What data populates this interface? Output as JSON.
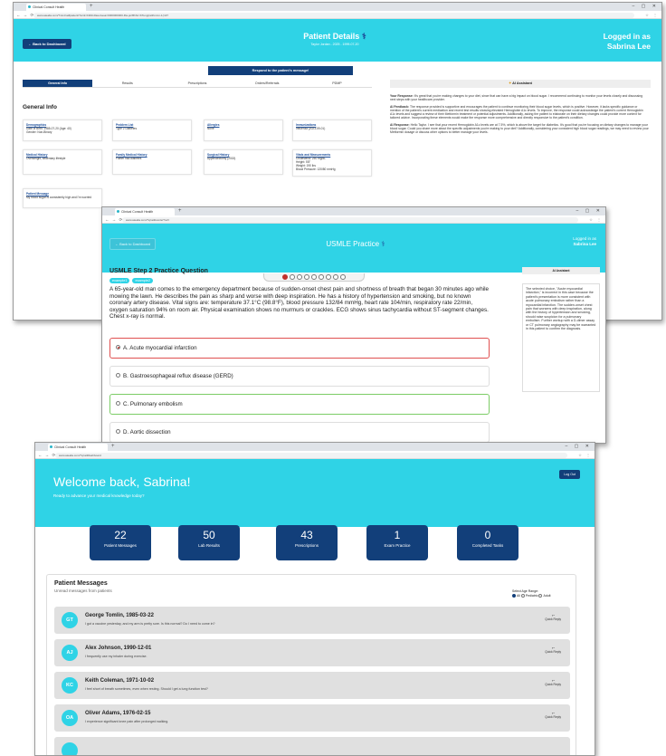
{
  "w1": {
    "tab": "Clinical Consult Health",
    "url": "www.atealia.com/?mini=ai#patient/?a=&=1990-Raw-baoa=0000000000-Rw-ja=Bhhn=KTeng(/atthmmn-1(=&?",
    "back": "← Back to Dashboard",
    "title": "Patient Details",
    "subtitle": "Taylor Jordan - 2025 - 1999-07-20",
    "logged_a": "Logged in as",
    "logged_b": "Sabrina Lee",
    "respond": "Respond to the patient's message!",
    "tabs": [
      "General Info",
      "Results",
      "Prescriptions",
      "Orders/Referrals",
      "PDMP"
    ],
    "section": "General Info",
    "cards": [
      {
        "t": "Demographics",
        "l": [
          "Date of Birth: 1985-07-20 (Age: 40)",
          "Gender: Non-Binary"
        ]
      },
      {
        "t": "Problem List",
        "l": [
          "Type 2 Diabetes"
        ]
      },
      {
        "t": "Allergies",
        "l": [
          "None"
        ]
      },
      {
        "t": "Immunizations",
        "l": [
          "Influenza (2023-09-01)"
        ]
      },
      {
        "t": "Medical History",
        "l": [
          "Overweight, sedentary lifestyle"
        ]
      },
      {
        "t": "Family Medical History",
        "l": [
          "Father had diabetes"
        ]
      },
      {
        "t": "Surgical History",
        "l": [
          "Appendectomy (2015)"
        ]
      },
      {
        "t": "Vitals and Measurements",
        "l": [
          "Cholesterol: 250 mg/dL",
          "Height: 5'8\"",
          "Weight: 190 lbs",
          "Blood Pressure: 120/80 mmHg"
        ]
      },
      {
        "t": "Patient Message",
        "l": [
          "My blood sugar is consistently high and I'm worried"
        ]
      }
    ],
    "ai_header": "AI Assistant",
    "ai": [
      {
        "k": "Your Response:",
        "v": "It's great that you're making changes to your diet, since that can have a big impact on blood sugar. I recommend continuing to monitor your levels closely and discussing next steps with your healthcare provider."
      },
      {
        "k": "AI Feedback:",
        "v": "The response provided is supportive and encourages the patient to continue monitoring their blood sugar levels, which is positive. However, it lacks specific guidance or mention of the patient's current medication and recent test results showing elevated Hemoglobin A1c levels. To improve, the response could acknowledge the patient's current Hemoglobin A1c levels and suggest a review of their Metformin treatment or potential adjustments. Additionally, asking the patient to elaborate on their dietary changes could provide more context for tailored advice. Incorporating these elements would make the response more comprehensive and directly responsive to the patient's condition."
      },
      {
        "k": "AI Response:",
        "v": "Hello Taylor. I see that your recent Hemoglobin A1c levels are at 7.5%, which is above the target for diabetics. It's good that you're focusing on dietary changes to manage your blood sugar. Could you share more about the specific adjustments you're making to your diet? Additionally, considering your consistent high blood sugar readings, we may need to review your Metformin dosage or discuss other options to better manage your levels."
      }
    ]
  },
  "w2": {
    "tab": "Clinical Consult Health",
    "url": "www.atealia.com/?q=ai#usmle/?ref=",
    "back": "← Back to Dashboard",
    "title": "USMLE Practice",
    "logged_a": "Logged in as",
    "logged_b": "Sabrina Lee",
    "qtitle": "USMLE Step 2 Practice Question",
    "tags": [
      "example1",
      "example2"
    ],
    "question": "A 65-year-old man comes to the emergency department because of sudden-onset chest pain and shortness of breath that began 30 minutes ago while mowing the lawn. He describes the pain as sharp and worse with deep inspiration. He has a history of hypertension and smoking, but no known coronary artery disease. Vital signs are: temperature 37.1°C (98.8°F), blood pressure 132/84 mmHg, heart rate 104/min, respiratory rate 22/min, oxygen saturation 94% on room air. Physical examination shows no murmurs or crackles. ECG shows sinus tachycardia without ST-segment changes. Chest x-ray is normal.",
    "options": [
      "A. Acute myocardial infarction",
      "B. Gastroesophageal reflux disease (GERD)",
      "C. Pulmonary embolism",
      "D. Aortic dissection"
    ],
    "selected_index": 0,
    "correct_index": 2,
    "current_question": 1,
    "question_count": 9,
    "ai_header": "AI Assistant",
    "ai_text": "The selected choice, \"Acute myocardial infarction,\" is incorrect in this case because the patient's presentation is more consistent with acute pulmonary embolism rather than a myocardial infarction. The sudden-onset chest pain that worsens with deep inspiration, along with the history of hypertension and smoking, should raise suspicion for a pulmonary embolism. Further workup with a D-dimer assay or CT pulmonary angiography may be warranted in this patient to confirm the diagnosis."
  },
  "w3": {
    "tab": "Clinical Consult Health",
    "url": "www.atealia.com/?q=ai#dashboard",
    "welcome": "Welcome back, Sabrina!",
    "ready": "Ready to advance your medical knowledge today?",
    "logout": "Log Out",
    "stats": [
      {
        "n": "22",
        "l": "Patient Messages"
      },
      {
        "n": "50",
        "l": "Lab Results"
      },
      {
        "n": "43",
        "l": "Prescriptions"
      },
      {
        "n": "1",
        "l": "Exam Practice"
      },
      {
        "n": "0",
        "l": "Completed Tasks"
      }
    ],
    "pm_title": "Patient Messages",
    "pm_sub": "Unread messages from patients",
    "age_label": "Select Age Range:",
    "age_opts": [
      "All",
      "Pediatric",
      "Adult"
    ],
    "quick": "Quick Reply",
    "msgs": [
      {
        "i": "GT",
        "n": "George Tomlin, 1985-03-22",
        "t": "I got a vaccine yesterday, and my arm is pretty sore. Is this normal? Do I need to come in?"
      },
      {
        "i": "AJ",
        "n": "Alex Johnson, 1990-12-01",
        "t": "I frequently use my inhaler during exercise."
      },
      {
        "i": "KC",
        "n": "Keith Coleman, 1971-10-02",
        "t": "I feel short of breath sometimes, even when resting. Should I get a lung function test?"
      },
      {
        "i": "OA",
        "n": "Oliver Adams, 1976-02-15",
        "t": "I experience significant knee pain after prolonged walking."
      }
    ]
  }
}
